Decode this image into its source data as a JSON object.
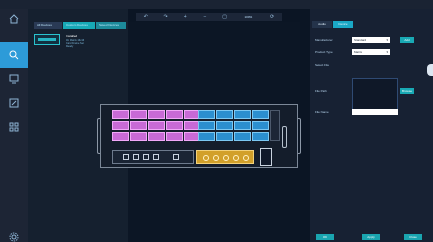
{
  "toolbar": {
    "zoom": "100%",
    "icons": [
      "undo-icon",
      "redo-icon",
      "zoom-in-icon",
      "zoom-out-icon",
      "fit-icon",
      "refresh-icon"
    ]
  },
  "device_panel": {
    "tabs": [
      "All Devices",
      "Custom Devices",
      "Saved Devices"
    ],
    "item": {
      "title": "Installed",
      "lines": [
        "4U Matrix 16x16",
        "Card Frame Set",
        "Ready"
      ]
    }
  },
  "sidebar": {
    "items": [
      "home-icon",
      "search-icon",
      "display-icon",
      "edit-icon",
      "grid-icon",
      "settings-icon"
    ],
    "selected": 1
  },
  "properties": {
    "tabs": [
      "Audio",
      "Device"
    ],
    "active_tab": 1,
    "manufacturer_label": "Manufacturer",
    "manufacturer_value": "Standard",
    "add_label": "Add",
    "product_label": "Product Type",
    "product_value": "Matrix",
    "select_file_label": "Select File",
    "file_path_label": "File Path",
    "browse_label": "Browse",
    "file_name_label": "File Name"
  },
  "footer_buttons": [
    "OK",
    "Apply",
    "Close"
  ],
  "colors": {
    "accent": "#1aa8c6",
    "input_card": "#c86ad6",
    "output_card": "#2b8fcf",
    "control_card": "#d2a02a"
  }
}
